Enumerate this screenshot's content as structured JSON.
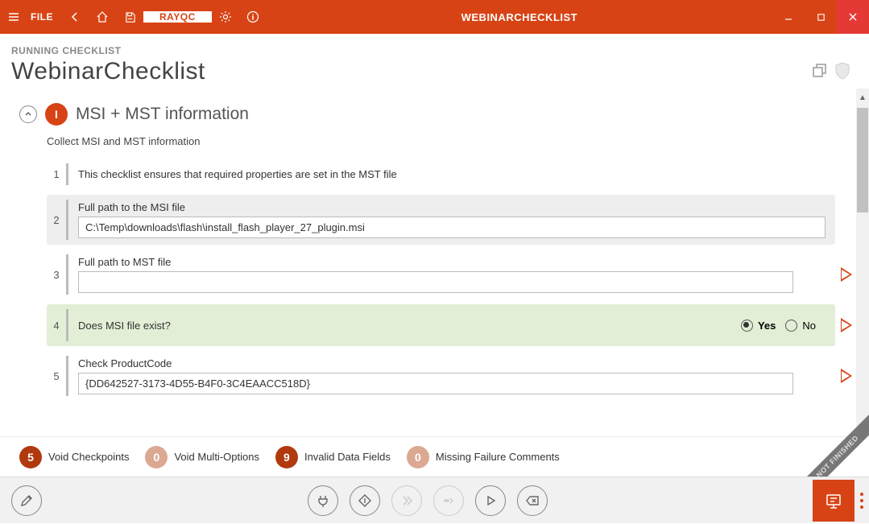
{
  "titlebar": {
    "file": "FILE",
    "tab": "RAYQC",
    "appTitle": "WEBINARCHECKLIST"
  },
  "header": {
    "subtitle": "RUNNING CHECKLIST",
    "title": "WebinarChecklist"
  },
  "section": {
    "badge": "I",
    "title": "MSI + MST information",
    "desc": "Collect MSI and MST information"
  },
  "rows": {
    "r1_num": "1",
    "r1_text": "This checklist ensures that required properties are set in the MST file",
    "r2_num": "2",
    "r2_label": "Full path to the MSI file",
    "r2_value": "C:\\Temp\\downloads\\flash\\install_flash_player_27_plugin.msi",
    "r3_num": "3",
    "r3_label": "Full path to MST file",
    "r3_value": "",
    "r4_num": "4",
    "r4_label": "Does MSI file exist?",
    "r4_yes": "Yes",
    "r4_no": "No",
    "r5_num": "5",
    "r5_label": "Check ProductCode",
    "r5_value": "{DD642527-3173-4D55-B4F0-3C4EAACC518D}"
  },
  "summary": {
    "s1_badge": "5",
    "s1_label": "Void Checkpoints",
    "s2_badge": "0",
    "s2_label": "Void Multi-Options",
    "s3_badge": "9",
    "s3_label": "Invalid Data Fields",
    "s4_badge": "0",
    "s4_label": "Missing Failure Comments"
  },
  "ribbon": "NOT FINISHED"
}
